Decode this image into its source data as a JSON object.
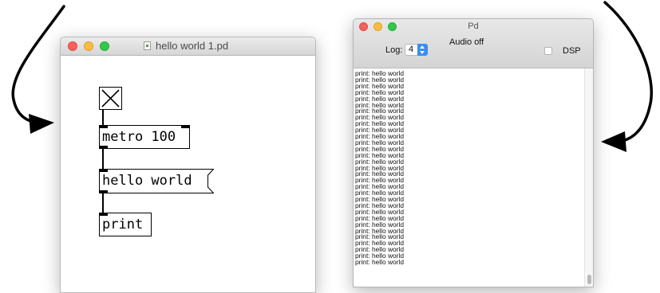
{
  "patch_window": {
    "title": "hello world 1.pd",
    "objects": {
      "toggle": {
        "state": "on"
      },
      "metro": {
        "text": "metro 100"
      },
      "message": {
        "text": "hello world"
      },
      "print": {
        "text": "print"
      }
    }
  },
  "pd_window": {
    "title": "Pd",
    "audio_status": "Audio off",
    "log_label": "Log:",
    "log_level": "4",
    "dsp_label": "DSP",
    "dsp_checked": false,
    "console_lines": [
      "print: hello world",
      "print: hello world",
      "print: hello world",
      "print: hello world",
      "print: hello world",
      "print: hello world",
      "print: hello world",
      "print: hello world",
      "print: hello world",
      "print: hello world",
      "print: hello world",
      "print: hello world",
      "print: hello world",
      "print: hello world",
      "print: hello world",
      "print: hello world",
      "print: hello world",
      "print: hello world",
      "print: hello world",
      "print: hello world",
      "print: hello world",
      "print: hello world",
      "print: hello world",
      "print: hello world",
      "print: hello world",
      "print: hello world",
      "print: hello world",
      "print: hello world",
      "print: hello world",
      "print: hello world",
      "print: hello world"
    ]
  },
  "colors": {
    "close": "#fc605c",
    "minimize": "#fdbc40",
    "maximize": "#34c84a",
    "accent": "#3b8cf1"
  }
}
